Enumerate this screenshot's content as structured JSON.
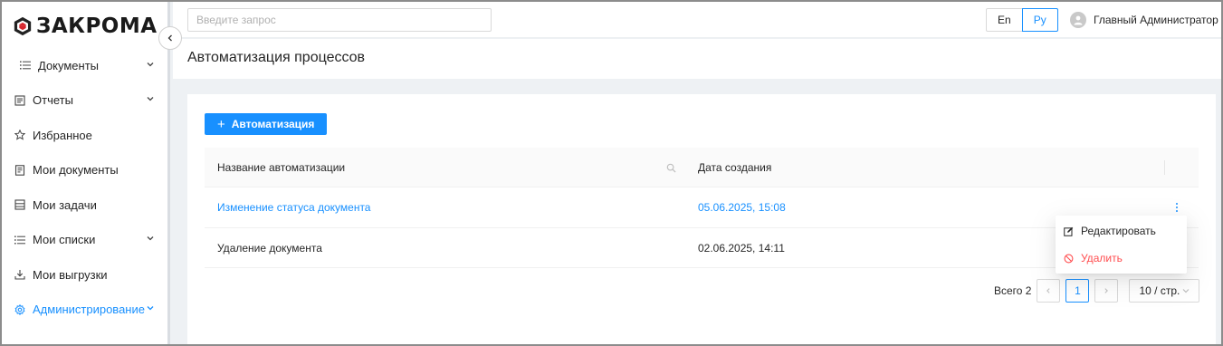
{
  "app": {
    "logo_text": "ЗАКРОМА"
  },
  "sidebar": {
    "items": [
      {
        "label": "Документы",
        "icon": "list-icon",
        "has_arrow": true
      },
      {
        "label": "Отчеты",
        "icon": "report-icon",
        "has_arrow": true
      },
      {
        "label": "Избранное",
        "icon": "star-icon",
        "has_arrow": false
      },
      {
        "label": "Мои документы",
        "icon": "document-icon",
        "has_arrow": false
      },
      {
        "label": "Мои задачи",
        "icon": "tasks-icon",
        "has_arrow": false
      },
      {
        "label": "Мои списки",
        "icon": "list-icon",
        "has_arrow": true
      },
      {
        "label": "Мои выгрузки",
        "icon": "download-icon",
        "has_arrow": false
      },
      {
        "label": "Администрирование",
        "icon": "gear-icon",
        "has_arrow": true,
        "active": true
      }
    ]
  },
  "header": {
    "search_placeholder": "Введите запрос",
    "lang_en": "En",
    "lang_ru": "Ру",
    "user_name": "Главный Администратор"
  },
  "page": {
    "title": "Автоматизация процессов"
  },
  "toolbar": {
    "add_label": "Автоматизация"
  },
  "table": {
    "columns": [
      "Название автоматизации",
      "Дата создания"
    ],
    "rows": [
      {
        "name": "Изменение статуса документа",
        "date": "05.06.2025, 15:08"
      },
      {
        "name": "Удаление документа",
        "date": "02.06.2025, 14:11"
      }
    ]
  },
  "context_menu": {
    "edit_label": "Редактировать",
    "delete_label": "Удалить"
  },
  "pagination": {
    "total_label": "Всего 2",
    "current_page": "1",
    "page_size": "10 / стр."
  },
  "colors": {
    "accent": "#1890ff",
    "danger": "#ff4d4f"
  }
}
